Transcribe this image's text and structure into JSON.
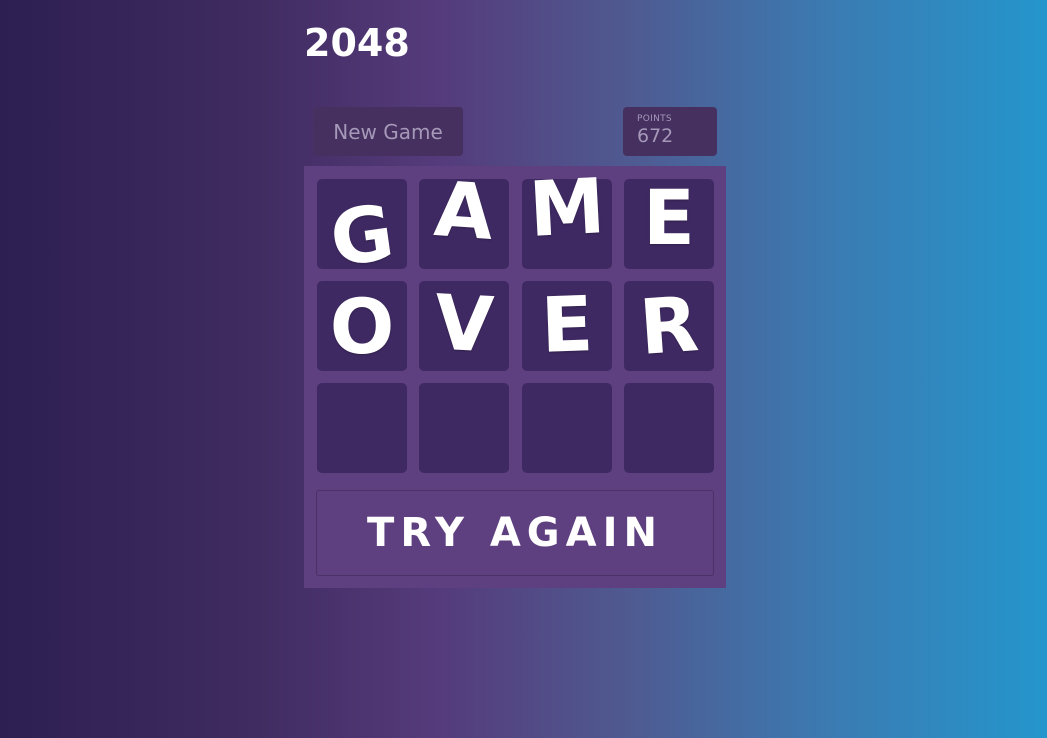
{
  "header": {
    "title": "2048"
  },
  "controls": {
    "new_game_label": "New Game",
    "points_label": "POINTS",
    "points_value": "672"
  },
  "board": {
    "rows": [
      [
        "G",
        "A",
        "M",
        "E"
      ],
      [
        "O",
        "V",
        "E",
        "R"
      ],
      [
        "",
        "",
        "",
        ""
      ]
    ]
  },
  "overlay": {
    "try_again_label": "TRY AGAIN"
  },
  "colors": {
    "background_start": "#2d1f52",
    "background_end": "#2496cc",
    "board": "#5e3f7f",
    "cell": "#3f2963",
    "button": "#45305f",
    "muted_text": "#a598b8",
    "letter": "#ffffff"
  }
}
